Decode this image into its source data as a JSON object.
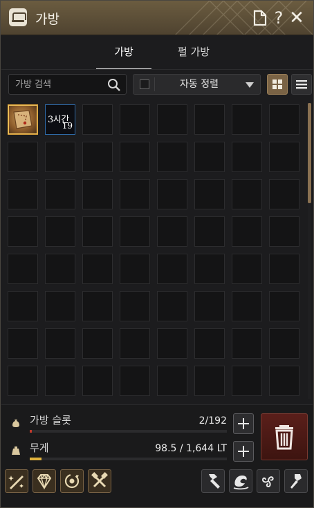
{
  "window": {
    "title": "가방",
    "icons": {
      "title": "bag-icon",
      "doc": "document-icon",
      "help": "help-icon",
      "close": "close-icon"
    },
    "help_label": "?",
    "close_label": "✕"
  },
  "tabs": [
    {
      "label": "가방",
      "active": true
    },
    {
      "label": "펄 가방",
      "active": false
    }
  ],
  "toolbar": {
    "search_placeholder": "가방 검색",
    "auto_sort_label": "자동 정렬",
    "auto_sort_checked": false,
    "view_mode": "grid"
  },
  "grid": {
    "columns": 8,
    "visible_rows": 8,
    "items": [
      {
        "slot": 0,
        "icon": "treasure-map-icon",
        "kind": "map"
      },
      {
        "slot": 1,
        "icon": "buff-scroll-icon",
        "kind": "timer",
        "time_label": "3시간",
        "count": "19"
      }
    ]
  },
  "footer": {
    "slots_label": "가방 슬롯",
    "slots_value": "2/192",
    "slots_fraction": 0.0104,
    "weight_label": "무게",
    "weight_value": "98.5 / 1,644 LT",
    "weight_fraction": 0.06,
    "tools_left": [
      "enhance-icon",
      "crystal-icon",
      "cycle-icon",
      "repair-icon"
    ],
    "tools_right": [
      "hammer-icon",
      "dragon-icon",
      "triskelion-icon",
      "forge-icon"
    ],
    "colors": {
      "accent": "#8a7152",
      "weight_fill": "#e0b23c",
      "slots_fill": "#c0392b",
      "trash": "#5a1f1a"
    }
  }
}
